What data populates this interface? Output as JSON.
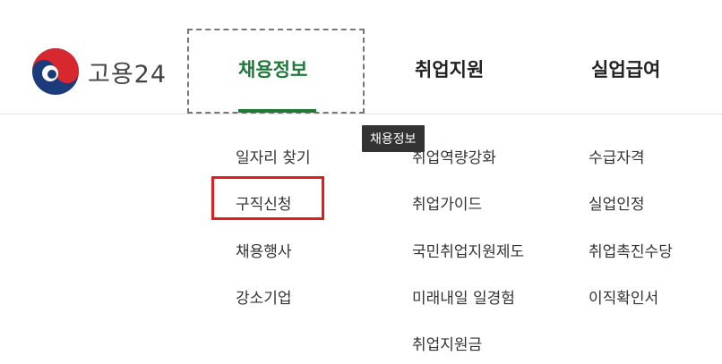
{
  "logo": {
    "text": "고용24",
    "icon": "taegeuk-logo-icon"
  },
  "nav": {
    "items": [
      {
        "label": "채용정보",
        "active": true
      },
      {
        "label": "취업지원",
        "active": false
      },
      {
        "label": "실업급여",
        "active": false
      }
    ]
  },
  "tooltip": {
    "text": "채용정보"
  },
  "submenu": {
    "col1": [
      "일자리 찾기",
      "구직신청",
      "채용행사",
      "강소기업"
    ],
    "col2": [
      "취업역량강화",
      "취업가이드",
      "국민취업지원제도",
      "미래내일 일경험",
      "취업지원금"
    ],
    "col3": [
      "수급자격",
      "실업인정",
      "취업촉진수당",
      "이직확인서"
    ]
  },
  "colors": {
    "accent_green": "#1f7a3a",
    "highlight_red": "#e01e1e",
    "logo_red": "#d7282f",
    "logo_blue": "#1b3b7a"
  }
}
